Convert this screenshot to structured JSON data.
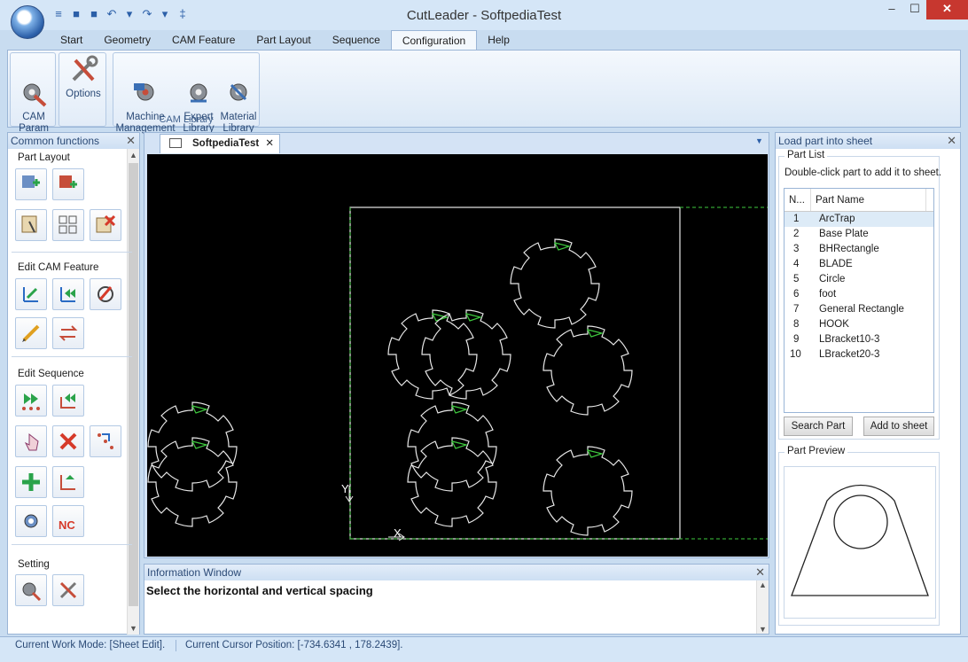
{
  "window": {
    "title": "CutLeader - SoftpediaTest",
    "minimize": "–",
    "maximize": "☐",
    "close": "✕"
  },
  "qat": {
    "items": [
      "≡",
      "■",
      "■",
      "↶",
      "▾",
      "↷",
      "▾",
      "‡"
    ]
  },
  "tabs": [
    {
      "label": "Start",
      "active": false
    },
    {
      "label": "Geometry",
      "active": false
    },
    {
      "label": "CAM Feature",
      "active": false
    },
    {
      "label": "Part Layout",
      "active": false
    },
    {
      "label": "Sequence",
      "active": false
    },
    {
      "label": "Configuration",
      "active": true
    },
    {
      "label": "Help",
      "active": false
    }
  ],
  "ribbon": {
    "cam_param": "CAM\nParam",
    "options": "Options",
    "machine": "Machine\nManagement",
    "expert": "Expert\nLibrary",
    "material": "Material\nLibrary",
    "group_label": "CAM Library"
  },
  "common_functions": {
    "title": "Common functions",
    "close": "✕",
    "sections": {
      "part_layout": "Part Layout",
      "edit_cam": "Edit CAM Feature",
      "edit_sequence": "Edit Sequence",
      "setting": "Setting"
    },
    "nc_label": "NC"
  },
  "document": {
    "tab_label": "SoftpediaTest",
    "close": "✕",
    "dropdown": "▼"
  },
  "canvas": {
    "y_label": "Y",
    "x_label": "X"
  },
  "info_window": {
    "title": "Information Window",
    "close": "✕",
    "message": "Select the horizontal and vertical spacing"
  },
  "status": {
    "work_mode": "Current Work Mode: [Sheet Edit].",
    "cursor": "Current Cursor Position: [-734.6341 , 178.2439]."
  },
  "load_part": {
    "title": "Load part into sheet",
    "close": "✕",
    "part_list_label": "Part List",
    "hint": "Double-click part to add it to sheet.",
    "col_num": "N...",
    "col_name": "Part Name",
    "parts": [
      {
        "n": "1",
        "name": "ArcTrap"
      },
      {
        "n": "2",
        "name": "Base Plate"
      },
      {
        "n": "3",
        "name": "BHRectangle"
      },
      {
        "n": "4",
        "name": "BLADE"
      },
      {
        "n": "5",
        "name": "Circle"
      },
      {
        "n": "6",
        "name": "foot"
      },
      {
        "n": "7",
        "name": "General Rectangle"
      },
      {
        "n": "8",
        "name": "HOOK"
      },
      {
        "n": "9",
        "name": "LBracket10-3"
      },
      {
        "n": "10",
        "name": "LBracket20-3"
      }
    ],
    "search_button": "Search Part",
    "add_button": "Add to sheet",
    "preview_label": "Part Preview"
  }
}
